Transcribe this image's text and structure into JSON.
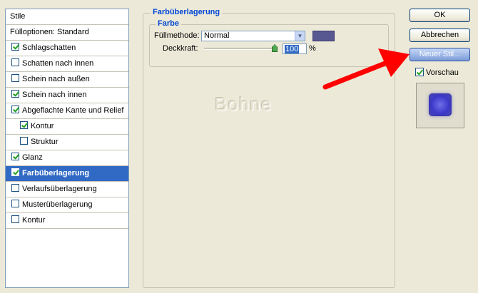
{
  "style_list": {
    "items": [
      {
        "label": "Stile",
        "checkbox": false
      },
      {
        "label": "Fülloptionen: Standard",
        "checkbox": false
      },
      {
        "label": "Schlagschatten",
        "checkbox": true,
        "checked": true
      },
      {
        "label": "Schatten nach innen",
        "checkbox": true,
        "checked": false
      },
      {
        "label": "Schein nach außen",
        "checkbox": true,
        "checked": false
      },
      {
        "label": "Schein nach innen",
        "checkbox": true,
        "checked": true
      },
      {
        "label": "Abgeflachte Kante und Relief",
        "checkbox": true,
        "checked": true
      },
      {
        "label": "Kontur",
        "checkbox": true,
        "checked": true,
        "indent": true
      },
      {
        "label": "Struktur",
        "checkbox": true,
        "checked": false,
        "indent": true
      },
      {
        "label": "Glanz",
        "checkbox": true,
        "checked": true
      },
      {
        "label": "Farbüberlagerung",
        "checkbox": true,
        "checked": true,
        "selected": true
      },
      {
        "label": "Verlaufsüberlagerung",
        "checkbox": true,
        "checked": false
      },
      {
        "label": "Musterüberlagerung",
        "checkbox": true,
        "checked": false
      },
      {
        "label": "Kontur",
        "checkbox": true,
        "checked": false
      }
    ]
  },
  "panel": {
    "title": "Farbüberlagerung",
    "subtitle": "Farbe",
    "blend_label": "Füllmethode:",
    "blend_value": "Normal",
    "color_swatch": "#575792",
    "opacity_label": "Deckkraft:",
    "opacity_value": "100",
    "opacity_unit": "%",
    "opacity_level": 1.0
  },
  "watermark": "Bohne",
  "buttons": {
    "ok": "OK",
    "cancel": "Abbrechen",
    "new_style": "Neuer Stil..."
  },
  "preview": {
    "label": "Vorschau",
    "checked": true
  },
  "colors": {
    "selection": "#316ac5",
    "title_blue": "#0046d5",
    "arrow_red": "#ff0000"
  }
}
